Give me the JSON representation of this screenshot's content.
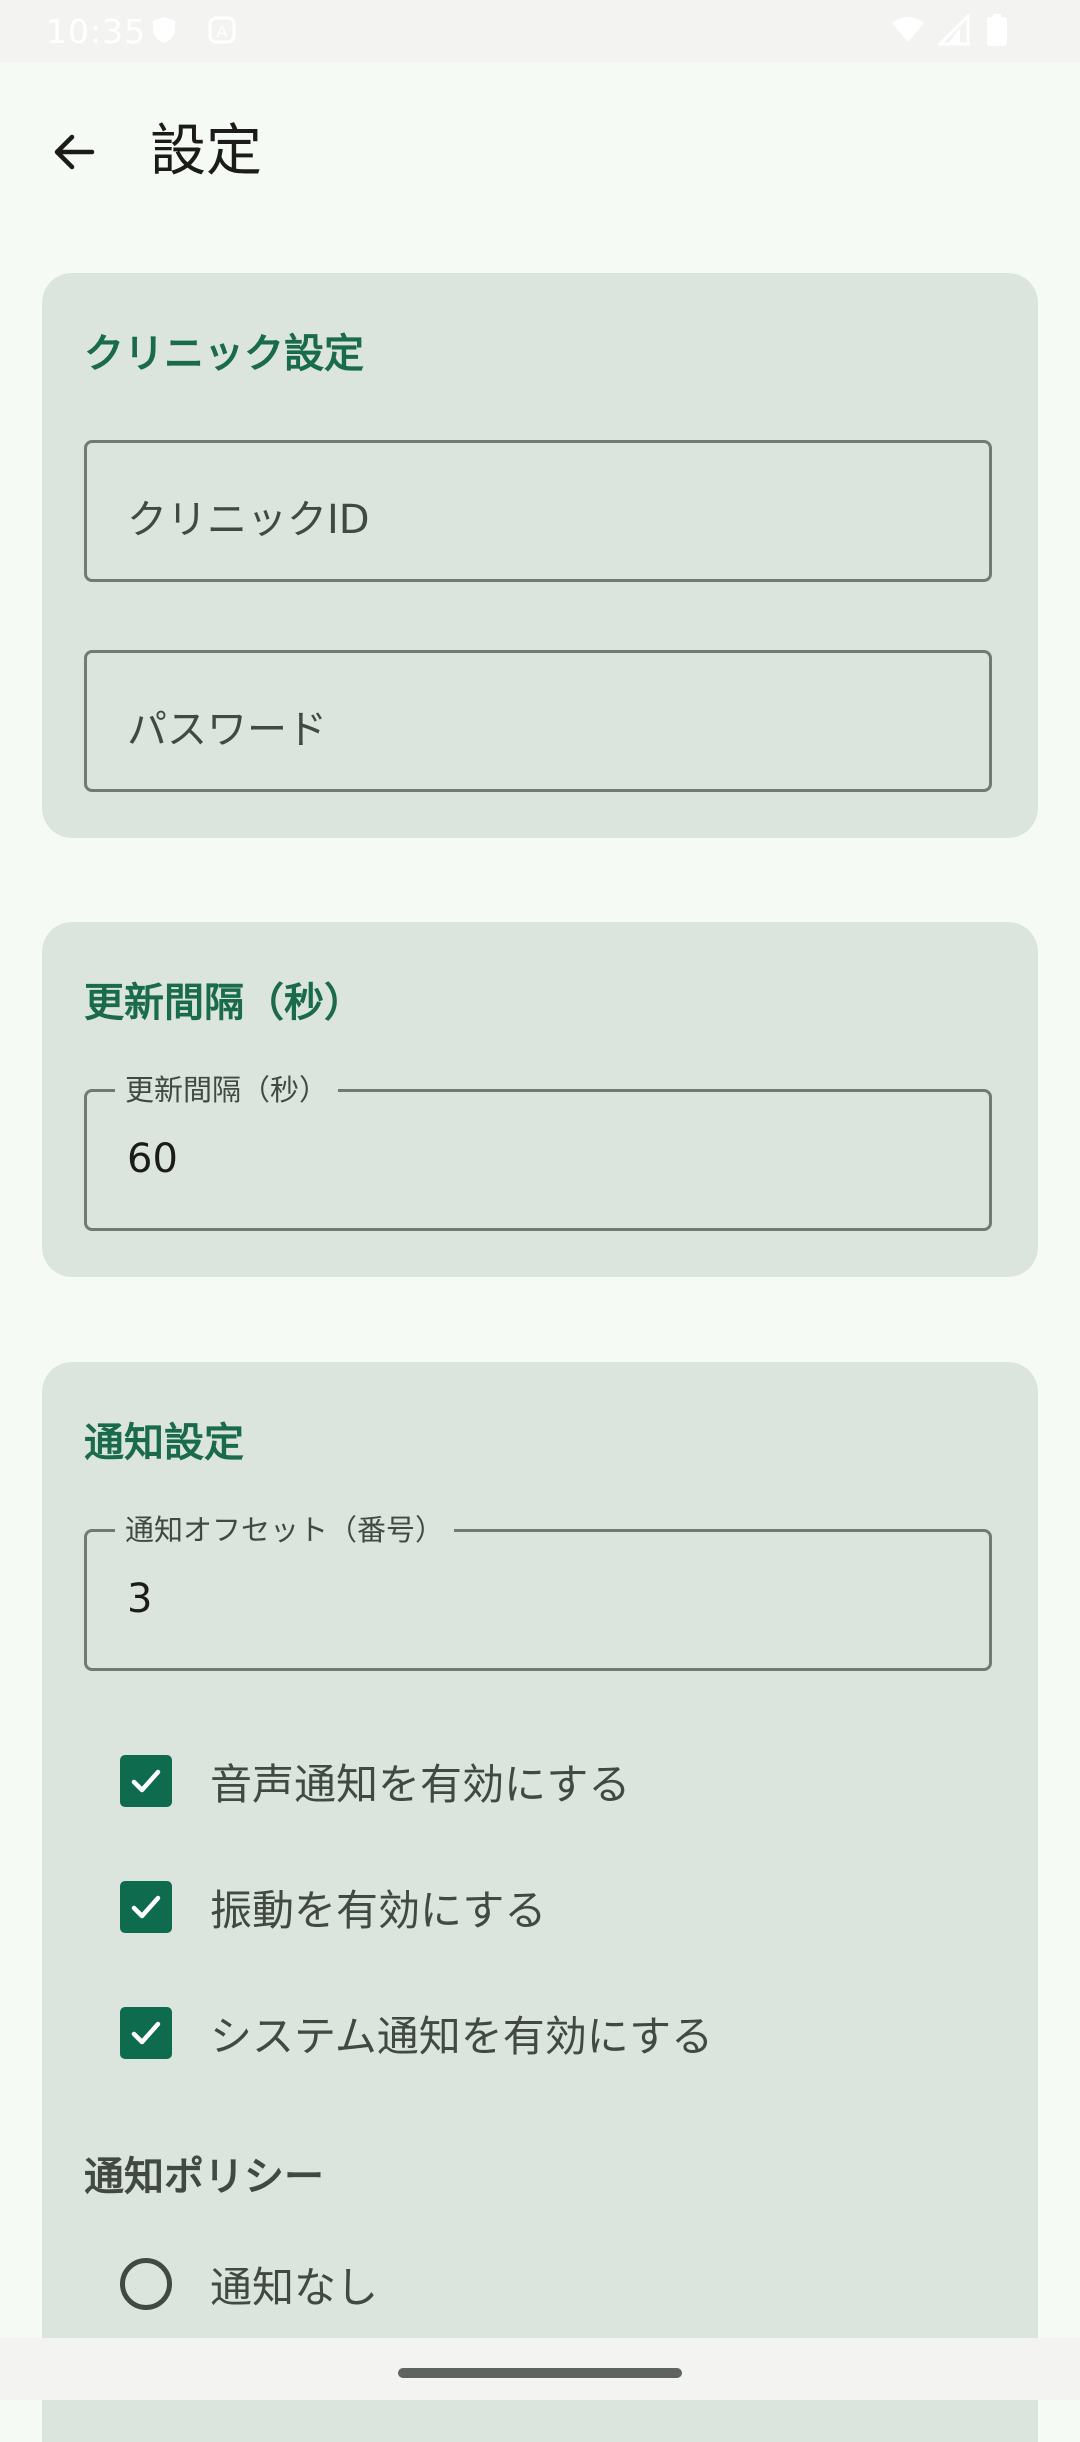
{
  "status_bar": {
    "time": "10:35",
    "icons": [
      "shield-icon",
      "notification-a-icon",
      "wifi-icon",
      "signal-icon",
      "battery-icon"
    ]
  },
  "app_bar": {
    "back_icon": "arrow-back-icon",
    "title": "設定"
  },
  "clinic_settings": {
    "title": "クリニック設定",
    "clinic_id": {
      "placeholder": "クリニックID",
      "value": ""
    },
    "password": {
      "placeholder": "パスワード",
      "value": ""
    }
  },
  "update_interval": {
    "title": "更新間隔（秒）",
    "field_label": "更新間隔（秒）",
    "value": "60"
  },
  "notification_settings": {
    "title": "通知設定",
    "offset_label": "通知オフセット（番号）",
    "offset_value": "3",
    "checkboxes": [
      {
        "label": "音声通知を有効にする",
        "checked": true
      },
      {
        "label": "振動を有効にする",
        "checked": true
      },
      {
        "label": "システム通知を有効にする",
        "checked": true
      }
    ],
    "policy_heading": "通知ポリシー",
    "policy_options": [
      {
        "label": "通知なし",
        "selected": false
      }
    ]
  },
  "colors": {
    "background": "#f6faf5",
    "card": "#dce5dd",
    "accent": "#0f6b4d",
    "card_title": "#1a6b4c",
    "text_secondary": "#414942"
  }
}
